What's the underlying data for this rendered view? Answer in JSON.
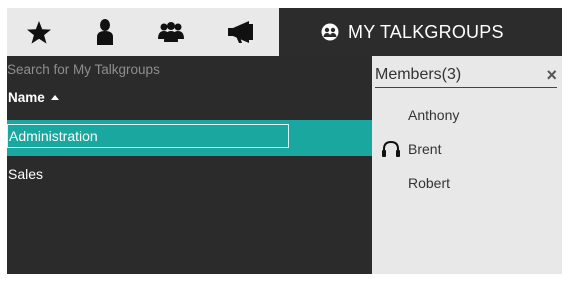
{
  "toolbar": {
    "tabs": [
      {
        "icon": "star-icon"
      },
      {
        "icon": "person-icon"
      },
      {
        "icon": "group-icon"
      },
      {
        "icon": "megaphone-icon"
      }
    ],
    "active_tab": {
      "icon": "talkgroups-icon",
      "label": "MY TALKGROUPS"
    }
  },
  "list": {
    "search_placeholder": "Search for My Talkgroups",
    "column_header": "Name",
    "sort": "ascending",
    "rows": [
      {
        "label": "Administration",
        "selected": true
      },
      {
        "label": "Sales",
        "selected": false
      }
    ]
  },
  "members": {
    "title": "Members(3)",
    "close_label": "×",
    "items": [
      {
        "name": "Anthony",
        "headset": false
      },
      {
        "name": "Brent",
        "headset": true
      },
      {
        "name": "Robert",
        "headset": false
      }
    ]
  },
  "colors": {
    "topbar_bg": "#2c2c2c",
    "tab_bg": "#e9e9e9",
    "panel_bg": "#2b2b2b",
    "selected_row": "#19a7a0",
    "members_bg": "#e8e8e8"
  }
}
